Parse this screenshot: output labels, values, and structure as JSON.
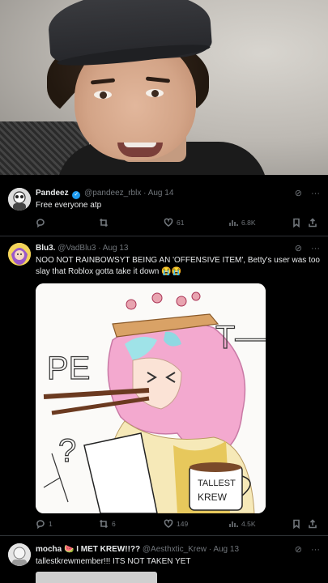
{
  "tweets": [
    {
      "display_name": "Pandeez",
      "handle": "@pandeez_rblx",
      "date": "Aug 14",
      "text": "Free everyone atp",
      "stats": {
        "replies": "",
        "reposts": "",
        "likes": "61",
        "views": "6.8K"
      }
    },
    {
      "display_name": "Blu3.",
      "handle": "@VadBlu3",
      "date": "Aug 13",
      "text": "NOO NOT RAINBOWSYT BEING AN 'OFFENSIVE ITEM', Betty's user was too slay that Roblox gotta take it down 😭😭",
      "image_text": {
        "pe_letters": "PE",
        "t_letters": "T—",
        "question": "?",
        "mug_line1": "TALLEST",
        "mug_line2": "KREW"
      },
      "stats": {
        "replies": "1",
        "reposts": "6",
        "likes": "149",
        "views": "4.5K"
      }
    },
    {
      "display_name": "mocha 🍉 I MET KREW!!??",
      "handle": "@Aesthxtic_Krew",
      "date": "Aug 13",
      "text": "tallestkrewmember!!!  ITS NOT TAKEN YET"
    }
  ],
  "icons": {
    "grok": "grok-icon",
    "more": "more-icon",
    "reply": "reply-icon",
    "repost": "repost-icon",
    "like": "heart-icon",
    "views": "views-icon",
    "bookmark": "bookmark-icon",
    "share": "share-icon"
  },
  "colors": {
    "verified": "#1d9bf0",
    "muted": "#71767b",
    "text": "#e7e9ea",
    "background": "#000000"
  }
}
